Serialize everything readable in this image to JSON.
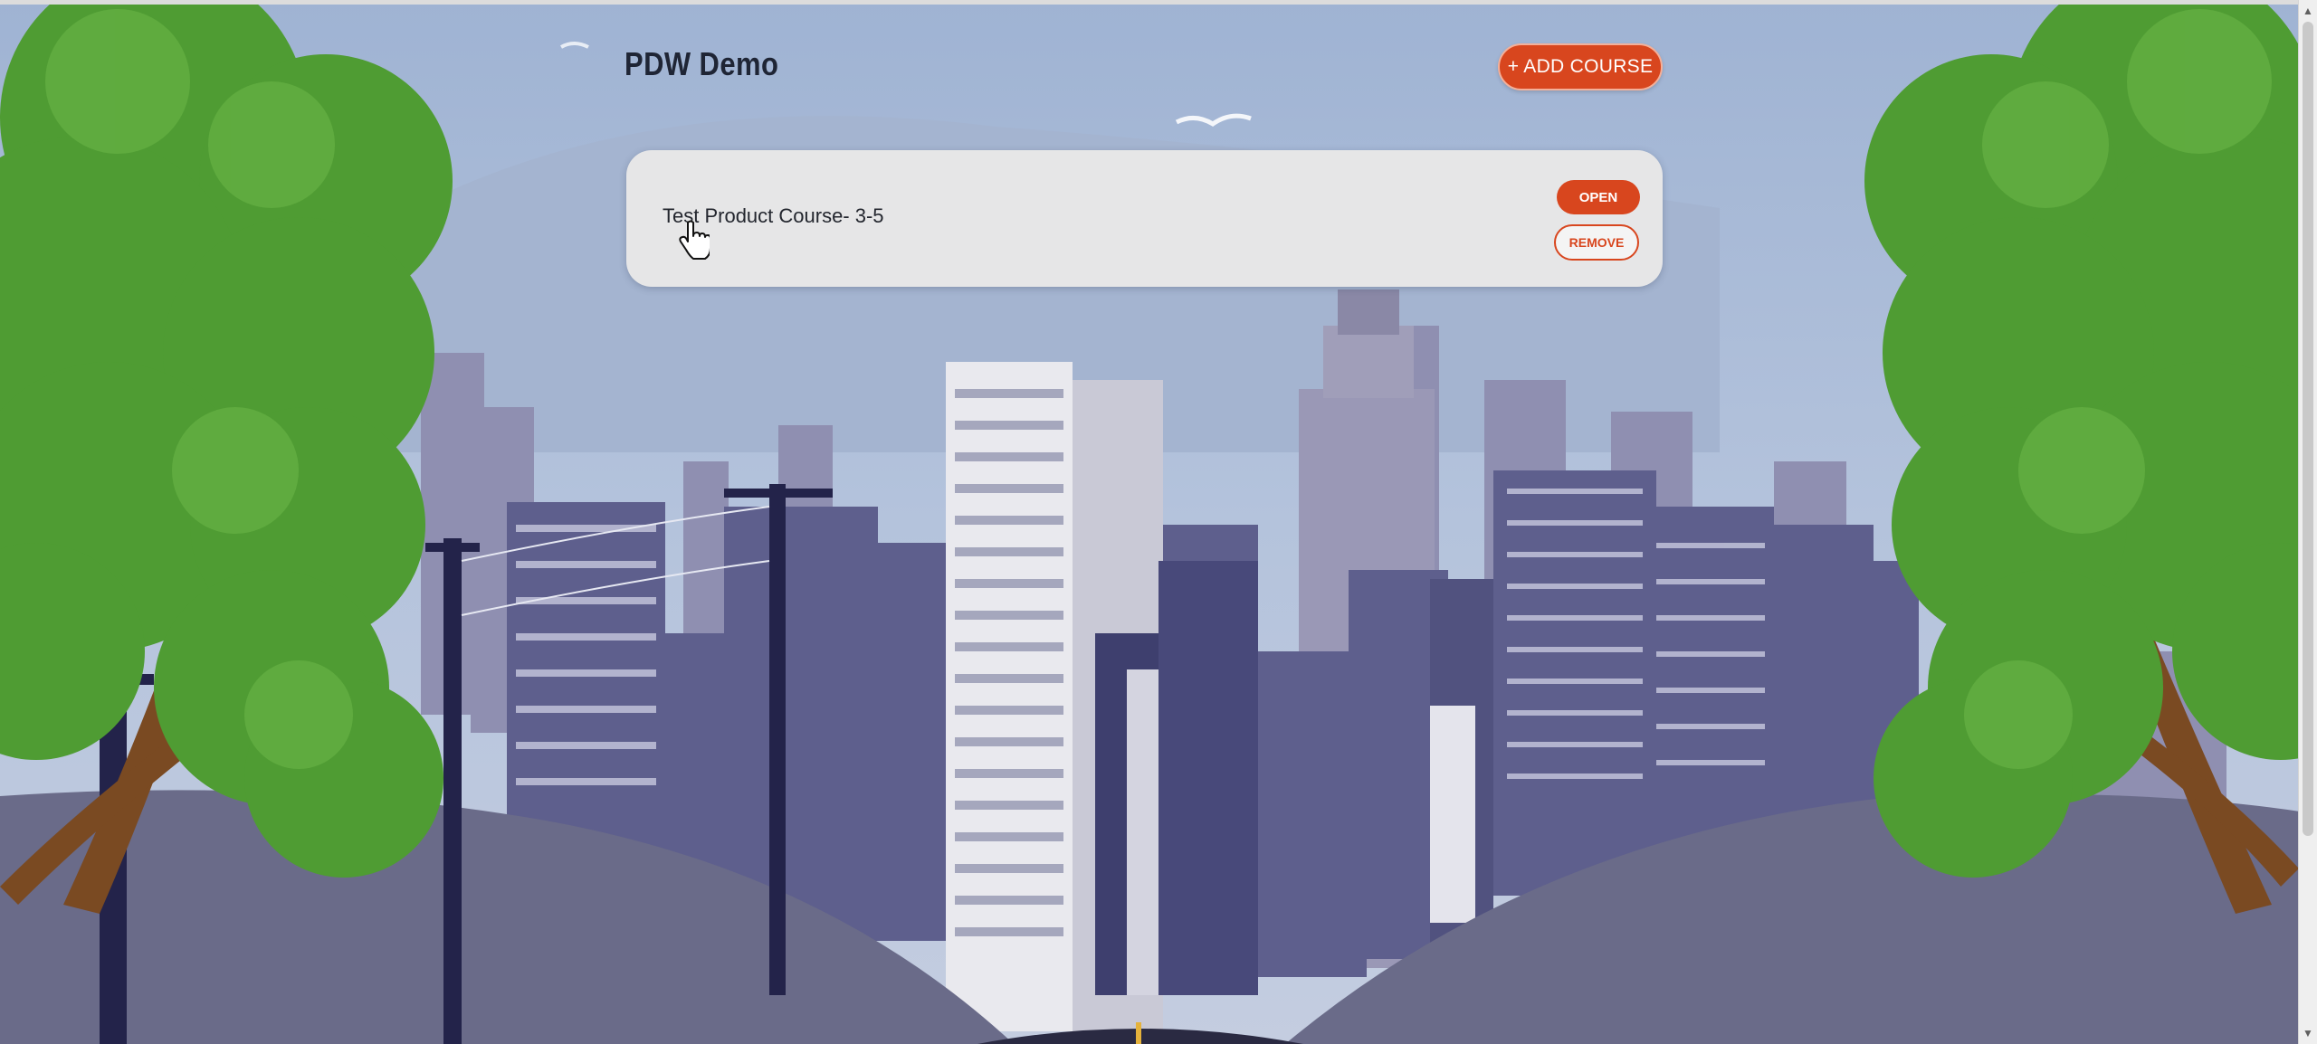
{
  "header": {
    "title": "PDW Demo",
    "add_course_label": "+ ADD COURSE"
  },
  "courses": [
    {
      "title": "Test Product Course- 3-5",
      "open_label": "OPEN",
      "remove_label": "REMOVE"
    }
  ],
  "icons": {
    "pointer": "hand-pointer-icon"
  },
  "colors": {
    "accent": "#d8461e",
    "card_background": "#e6e6e7",
    "sky": "#a9bbd6",
    "title_text": "#1f2535"
  }
}
